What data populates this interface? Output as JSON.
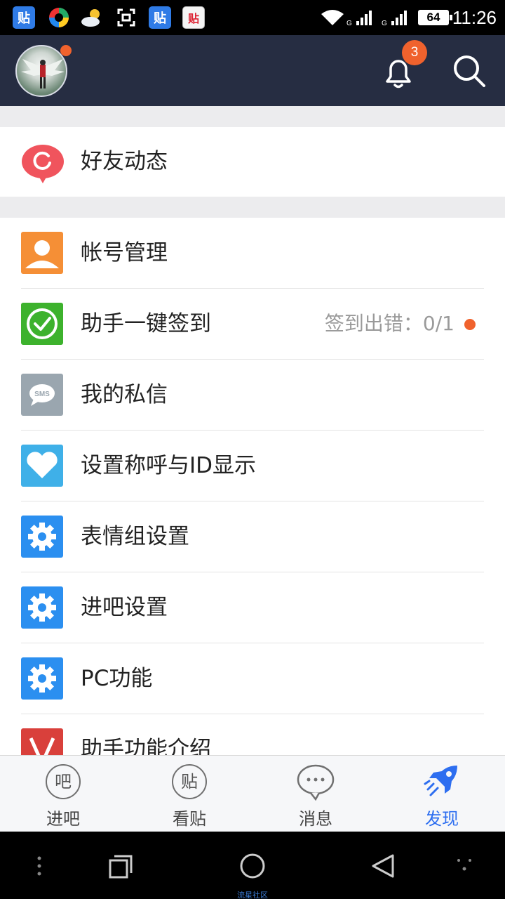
{
  "status_bar": {
    "icons": [
      "tieba-icon",
      "colorful-app-icon",
      "weather-sunny-cloud-icon",
      "screenshot-icon",
      "tieba-icon",
      "tieba-alt-icon"
    ],
    "app_icon_text": "贴",
    "battery": "64",
    "time": "11:26"
  },
  "header": {
    "notification_count": "3"
  },
  "friend_feed": {
    "label": "好友动态"
  },
  "menu": [
    {
      "label": "帐号管理",
      "icon": "user-icon",
      "color": "#f58f36"
    },
    {
      "label": "助手一键签到",
      "icon": "checkmark-icon",
      "color": "#3db22d",
      "status": "签到出错：0/1"
    },
    {
      "label": "我的私信",
      "icon": "sms-icon",
      "color": "#9aa6af"
    },
    {
      "label": "设置称呼与ID显示",
      "icon": "heart-icon",
      "color": "#3fb0e8"
    },
    {
      "label": "表情组设置",
      "icon": "gear-icon",
      "color": "#2b8ff0"
    },
    {
      "label": "进吧设置",
      "icon": "gear-icon",
      "color": "#2b8ff0"
    },
    {
      "label": "PC功能",
      "icon": "gear-icon",
      "color": "#2b8ff0"
    },
    {
      "label": "助手功能介绍",
      "icon": "v-logo-icon",
      "color": "#d9403b"
    }
  ],
  "tabs": [
    {
      "glyph": "吧",
      "label": "进吧"
    },
    {
      "glyph": "贴",
      "label": "看贴"
    },
    {
      "glyph": "···",
      "label": "消息"
    },
    {
      "glyph": "",
      "label": "发现",
      "active": true
    }
  ],
  "accent_color": "#2d6ef0",
  "nav_caption": "流星社区"
}
